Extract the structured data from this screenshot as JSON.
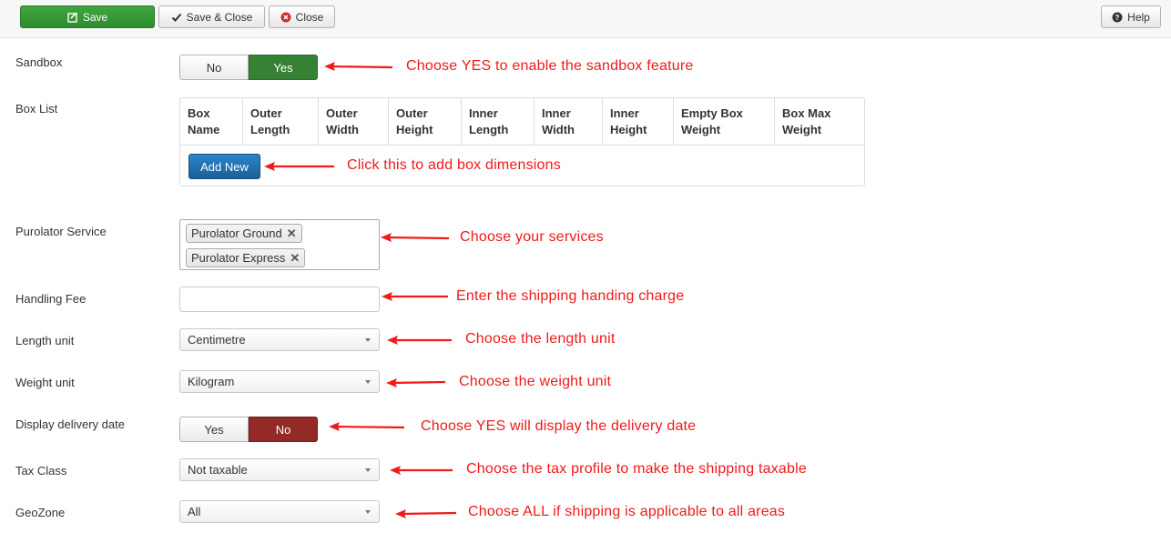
{
  "toolbar": {
    "save_label": "Save",
    "save_close_label": "Save & Close",
    "close_label": "Close",
    "help_label": "Help"
  },
  "form": {
    "sandbox": {
      "label": "Sandbox",
      "no": "No",
      "yes": "Yes",
      "selected": "Yes"
    },
    "box_list": {
      "label": "Box List",
      "columns": [
        [
          "Box",
          "Name"
        ],
        [
          "Outer",
          "Length"
        ],
        [
          "Outer",
          "Width"
        ],
        [
          "Outer",
          "Height"
        ],
        [
          "Inner",
          "Length"
        ],
        [
          "Inner",
          "Width"
        ],
        [
          "Inner",
          "Height"
        ],
        [
          "Empty Box",
          "Weight"
        ],
        [
          "Box Max",
          "Weight"
        ]
      ],
      "add_new_label": "Add New"
    },
    "purolator_service": {
      "label": "Purolator Service",
      "selected": [
        "Purolator Ground",
        "Purolator Express"
      ],
      "remove_symbol": "✕"
    },
    "handling_fee": {
      "label": "Handling Fee",
      "value": ""
    },
    "length_unit": {
      "label": "Length unit",
      "value": "Centimetre"
    },
    "weight_unit": {
      "label": "Weight unit",
      "value": "Kilogram"
    },
    "display_delivery_date": {
      "label": "Display delivery date",
      "yes": "Yes",
      "no": "No",
      "selected": "No"
    },
    "tax_class": {
      "label": "Tax Class",
      "value": "Not taxable"
    },
    "geozone": {
      "label": "GeoZone",
      "value": "All"
    }
  },
  "annotations": {
    "sandbox": "Choose YES to enable the sandbox feature",
    "add_new": "Click this to add box dimensions",
    "services": "Choose your services",
    "handling_fee": "Enter the shipping handing charge",
    "length_unit": "Choose the length unit",
    "weight_unit": "Choose the weight unit",
    "delivery_date": "Choose YES will display the delivery date",
    "tax_class": "Choose the tax profile to make the shipping taxable",
    "geozone": "Choose ALL if shipping is applicable to all areas"
  },
  "colors": {
    "annotation": "#f01a1a",
    "save_green": "#378137",
    "no_red": "#942a25",
    "add_new_blue": "#1b5f9a"
  },
  "icons": {
    "save": "edit-square-icon",
    "save_close": "checkmark-icon",
    "close": "close-circle-icon",
    "help": "question-circle-icon"
  }
}
